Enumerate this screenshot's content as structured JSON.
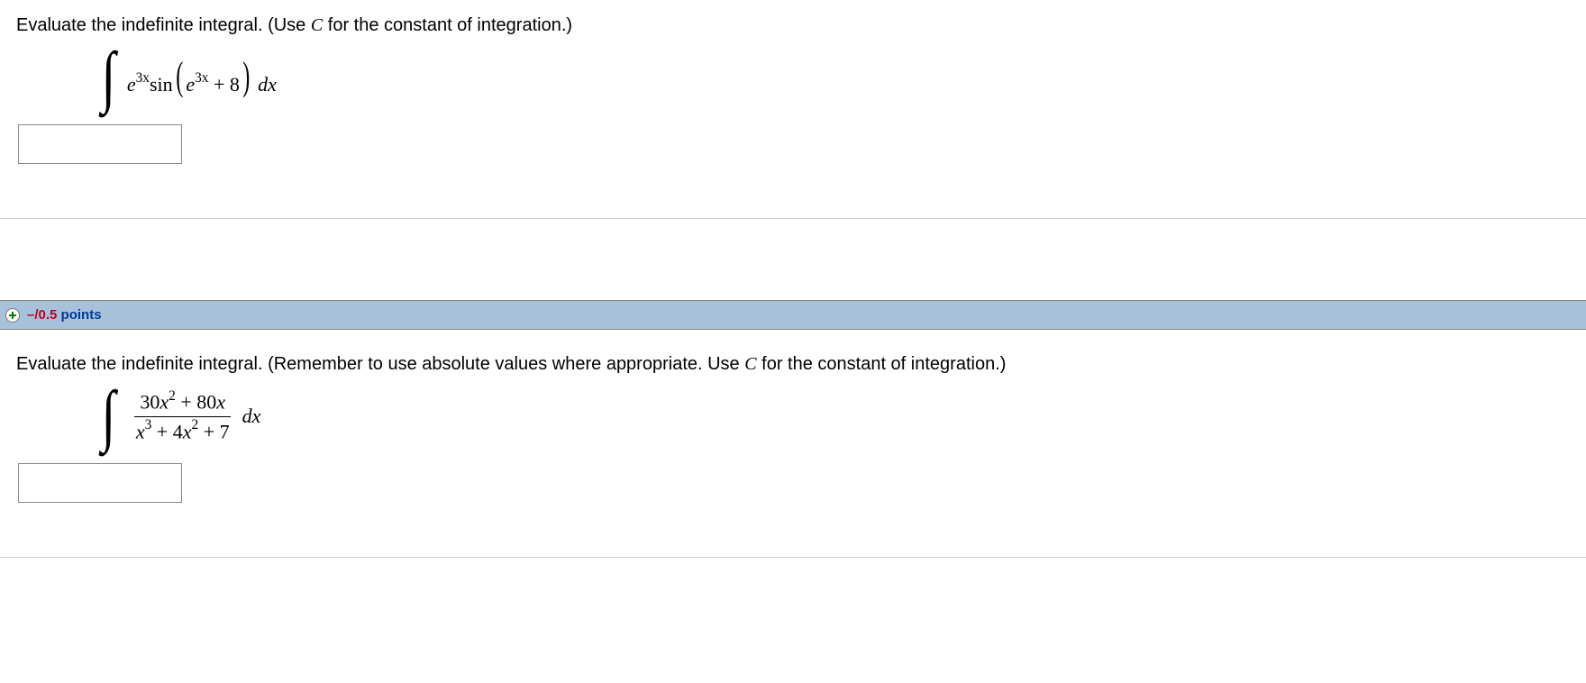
{
  "q1": {
    "prompt_a": "Evaluate the indefinite integral. (Use ",
    "prompt_b": " for the constant of integration.)",
    "const_var": "C",
    "math": {
      "e": "e",
      "exp": "3x",
      "sin": "sin",
      "plus8": " + 8",
      "dx": " dx"
    },
    "answer": ""
  },
  "points_bar": {
    "score": "–/0.5",
    "label": " points"
  },
  "q2": {
    "prompt_a": "Evaluate the indefinite integral. (Remember to use absolute values where appropriate. Use ",
    "prompt_b": " for the constant of integration.)",
    "const_var": "C",
    "math": {
      "num_a": "30",
      "num_b": " + 80",
      "den_a": " + 4",
      "den_b": " + 7",
      "x": "x",
      "sq": "2",
      "cu": "3",
      "dx": " dx"
    },
    "answer": ""
  }
}
